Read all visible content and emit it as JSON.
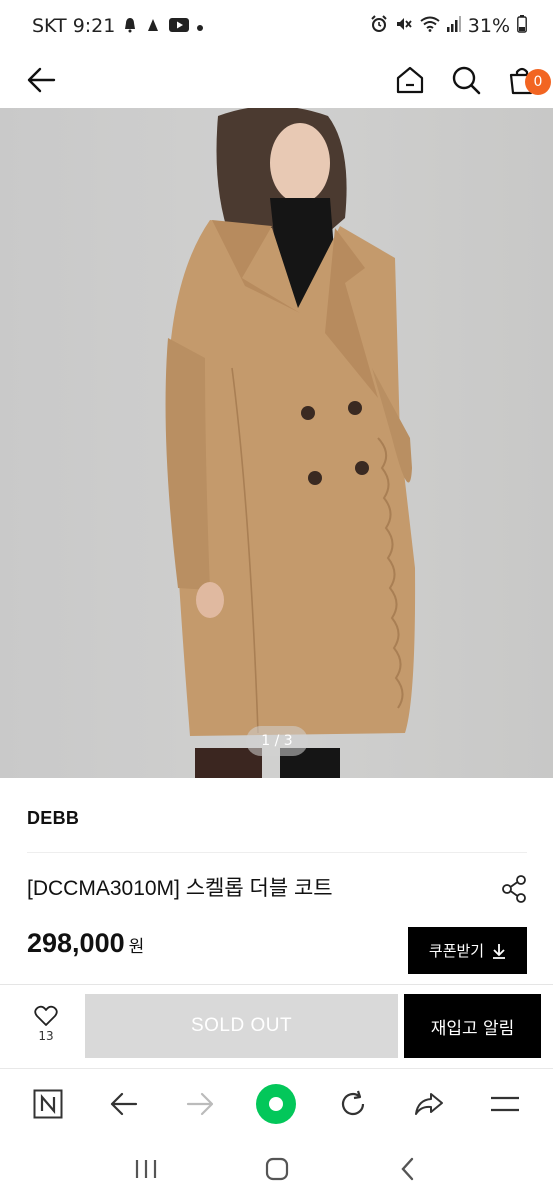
{
  "status_bar": {
    "carrier_time": "SKT 9:21",
    "battery": "31%",
    "left_icons": [
      "notification-icon",
      "notification-icon",
      "youtube-icon",
      "dot-icon"
    ],
    "right_icons": [
      "alarm-icon",
      "mute-icon",
      "wifi-icon",
      "signal-icon",
      "battery-icon"
    ]
  },
  "header": {
    "cart_count": "0"
  },
  "gallery": {
    "counter": "1 / 3"
  },
  "product": {
    "brand": "DEBB",
    "name": "[DCCMA3010M] 스켈롭 더블 코트",
    "price": "298,000",
    "currency": "원",
    "coupon_label": "쿠폰받기"
  },
  "purchase_bar": {
    "like_count": "13",
    "soldout_label": "SOLD OUT",
    "restock_label": "재입고 알림"
  },
  "colors": {
    "accent": "#f26522",
    "naver_green": "#03c75a",
    "coat": "#c49a6c"
  }
}
